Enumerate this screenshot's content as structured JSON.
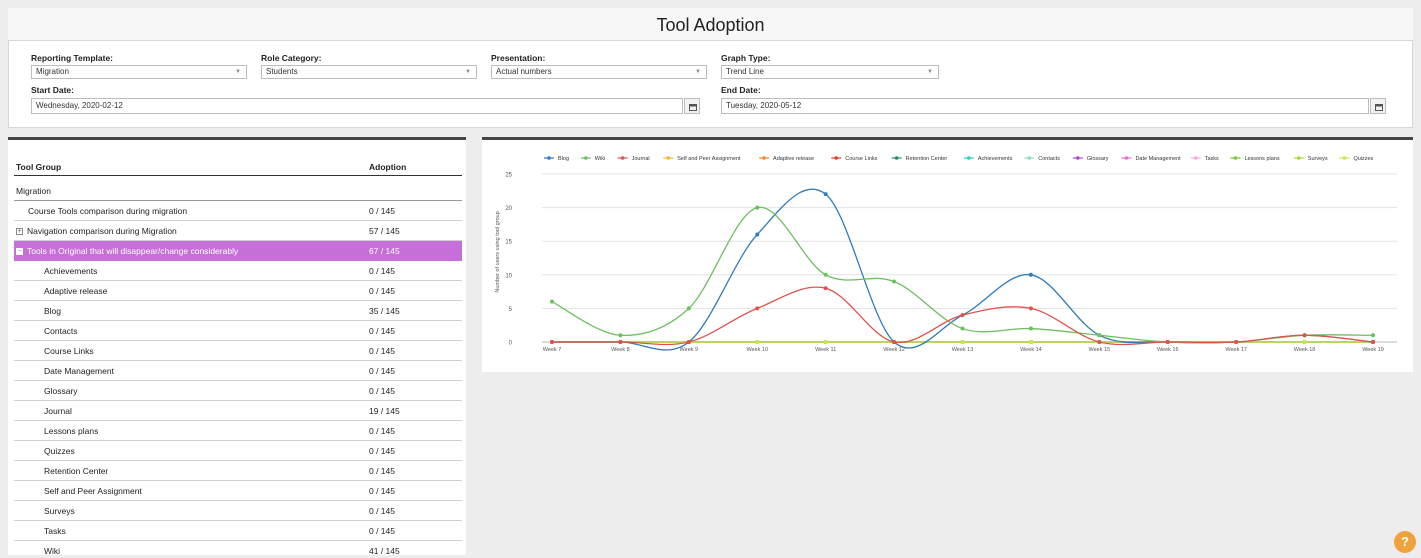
{
  "page": {
    "title": "Tool Adoption"
  },
  "filters": {
    "reporting_template": {
      "label": "Reporting Template:",
      "value": "Migration"
    },
    "role_category": {
      "label": "Role Category:",
      "value": "Students"
    },
    "presentation": {
      "label": "Presentation:",
      "value": "Actual numbers"
    },
    "graph_type": {
      "label": "Graph Type:",
      "value": "Trend Line"
    },
    "start_date": {
      "label": "Start Date:",
      "value": "Wednesday, 2020-02-12"
    },
    "end_date": {
      "label": "End Date:",
      "value": "Tuesday, 2020-05-12"
    }
  },
  "table": {
    "headers": {
      "group": "Tool Group",
      "adoption": "Adoption"
    },
    "rows": [
      {
        "name": "Migration",
        "adoption": "",
        "level": 0
      },
      {
        "name": "Course Tools comparison during migration",
        "adoption": "0 / 145",
        "level": 1
      },
      {
        "name": "Navigation comparison during Migration",
        "adoption": "57 / 145",
        "level": 1,
        "expander": "+"
      },
      {
        "name": "Tools in Original that will disappear/change considerably",
        "adoption": "67 / 145",
        "level": 1,
        "expander": "−",
        "highlighted": true
      },
      {
        "name": "Achievements",
        "adoption": "0 / 145",
        "level": 2
      },
      {
        "name": "Adaptive release",
        "adoption": "0 / 145",
        "level": 2
      },
      {
        "name": "Blog",
        "adoption": "35 / 145",
        "level": 2
      },
      {
        "name": "Contacts",
        "adoption": "0 / 145",
        "level": 2
      },
      {
        "name": "Course Links",
        "adoption": "0 / 145",
        "level": 2
      },
      {
        "name": "Date Management",
        "adoption": "0 / 145",
        "level": 2
      },
      {
        "name": "Glossary",
        "adoption": "0 / 145",
        "level": 2
      },
      {
        "name": "Journal",
        "adoption": "19 / 145",
        "level": 2
      },
      {
        "name": "Lessons plans",
        "adoption": "0 / 145",
        "level": 2
      },
      {
        "name": "Quizzes",
        "adoption": "0 / 145",
        "level": 2
      },
      {
        "name": "Retention Center",
        "adoption": "0 / 145",
        "level": 2
      },
      {
        "name": "Self and Peer Assignment",
        "adoption": "0 / 145",
        "level": 2
      },
      {
        "name": "Surveys",
        "adoption": "0 / 145",
        "level": 2
      },
      {
        "name": "Tasks",
        "adoption": "0 / 145",
        "level": 2
      },
      {
        "name": "Wiki",
        "adoption": "41 / 145",
        "level": 2
      }
    ]
  },
  "chart_data": {
    "type": "line",
    "title": "",
    "xlabel": "",
    "ylabel": "Number of users using tool group",
    "ylim": [
      0,
      25
    ],
    "yticks": [
      0,
      5,
      10,
      15,
      20,
      25
    ],
    "categories": [
      "Week 7",
      "Week 8",
      "Week 9",
      "Week 10",
      "Week 11",
      "Week 12",
      "Week 13",
      "Week 14",
      "Week 15",
      "Week 16",
      "Week 17",
      "Week 18",
      "Week 19"
    ],
    "grid": true,
    "legend_position": "top",
    "series": [
      {
        "name": "Blog",
        "color": "#2f7bbd",
        "values": [
          0,
          0,
          0,
          16,
          22,
          0,
          4,
          10,
          1,
          0,
          0,
          1,
          0
        ]
      },
      {
        "name": "Wiki",
        "color": "#6cbf5f",
        "values": [
          6,
          1,
          5,
          20,
          10,
          9,
          2,
          2,
          1,
          0,
          0,
          1,
          1
        ]
      },
      {
        "name": "Journal",
        "color": "#e0534d",
        "values": [
          0,
          0,
          0,
          5,
          8,
          0,
          4,
          5,
          0,
          0,
          0,
          1,
          0
        ]
      },
      {
        "name": "Self and Peer Assignment",
        "color": "#f5b731",
        "values": [
          0,
          0,
          0,
          0,
          0,
          0,
          0,
          0,
          0,
          0,
          0,
          0,
          0
        ]
      },
      {
        "name": "Adaptive release",
        "color": "#f08a2c",
        "values": [
          0,
          0,
          0,
          0,
          0,
          0,
          0,
          0,
          0,
          0,
          0,
          0,
          0
        ]
      },
      {
        "name": "Course Links",
        "color": "#d8402a",
        "values": [
          0,
          0,
          0,
          0,
          0,
          0,
          0,
          0,
          0,
          0,
          0,
          0,
          0
        ]
      },
      {
        "name": "Retention Center",
        "color": "#1f8f73",
        "values": [
          0,
          0,
          0,
          0,
          0,
          0,
          0,
          0,
          0,
          0,
          0,
          0,
          0
        ]
      },
      {
        "name": "Achievements",
        "color": "#2ed0b8",
        "values": [
          0,
          0,
          0,
          0,
          0,
          0,
          0,
          0,
          0,
          0,
          0,
          0,
          0
        ]
      },
      {
        "name": "Contacts",
        "color": "#8fdcc8",
        "values": [
          0,
          0,
          0,
          0,
          0,
          0,
          0,
          0,
          0,
          0,
          0,
          0,
          0
        ]
      },
      {
        "name": "Glossary",
        "color": "#b146c6",
        "values": [
          0,
          0,
          0,
          0,
          0,
          0,
          0,
          0,
          0,
          0,
          0,
          0,
          0
        ]
      },
      {
        "name": "Date Management",
        "color": "#e86fd8",
        "values": [
          0,
          0,
          0,
          0,
          0,
          0,
          0,
          0,
          0,
          0,
          0,
          0,
          0
        ]
      },
      {
        "name": "Tasks",
        "color": "#f7a9d8",
        "values": [
          0,
          0,
          0,
          0,
          0,
          0,
          0,
          0,
          0,
          0,
          0,
          0,
          0
        ]
      },
      {
        "name": "Lessons plans",
        "color": "#6fc83a",
        "values": [
          0,
          0,
          0,
          0,
          0,
          0,
          0,
          0,
          0,
          0,
          0,
          0,
          0
        ]
      },
      {
        "name": "Surveys",
        "color": "#a3d93f",
        "values": [
          0,
          0,
          0,
          0,
          0,
          0,
          0,
          0,
          0,
          0,
          0,
          0,
          0
        ]
      },
      {
        "name": "Quizzes",
        "color": "#c6e84a",
        "values": [
          0,
          0,
          0,
          0,
          0,
          0,
          0,
          0,
          0,
          0,
          0,
          0,
          0
        ]
      }
    ]
  },
  "help": {
    "icon": "question-icon",
    "label": "?"
  }
}
